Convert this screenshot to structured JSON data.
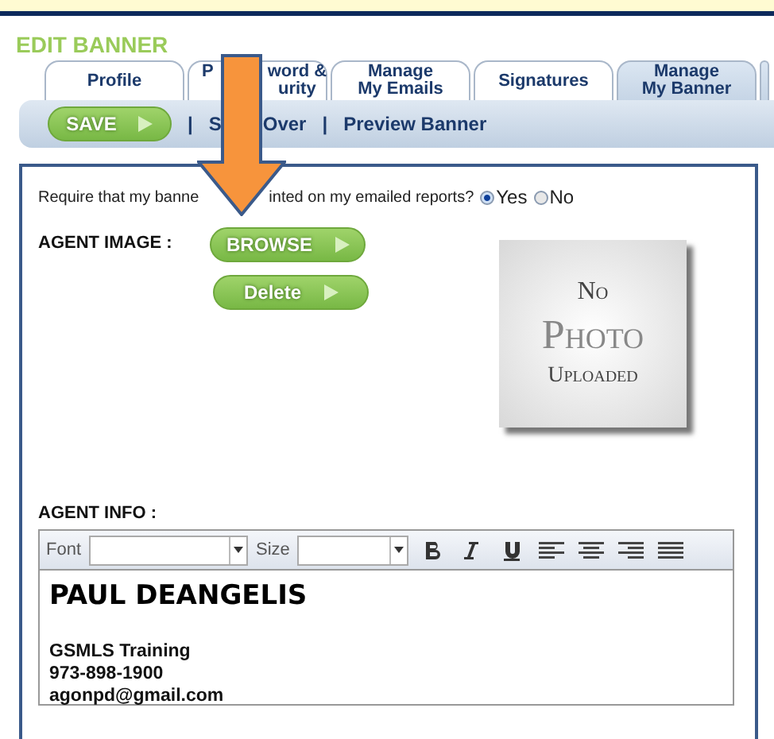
{
  "section_title": "EDIT BANNER",
  "tabs": [
    {
      "lines": [
        "Profile"
      ],
      "selected": false
    },
    {
      "lines": [
        {
          "before": "P",
          "after": "word &"
        },
        {
          "after": "urity"
        }
      ],
      "selected": false
    },
    {
      "lines": [
        "Manage",
        "My Emails"
      ],
      "selected": false
    },
    {
      "lines": [
        "Signatures"
      ],
      "selected": false
    },
    {
      "lines": [
        "Manage",
        "My Banner"
      ],
      "selected": true
    }
  ],
  "toolbar": [
    {
      "kind": "button",
      "label": "SAVE"
    },
    {
      "kind": "separator",
      "text": "|"
    },
    {
      "kind": "link",
      "before": "S",
      "after": "Over"
    },
    {
      "kind": "separator",
      "text": "|"
    },
    {
      "kind": "link",
      "label": "Preview Banner"
    }
  ],
  "question": {
    "before": "Require that my banne",
    "after": "inted on my emailed reports?",
    "options": [
      {
        "label": "Yes",
        "selected": true
      },
      {
        "label": "No",
        "selected": false
      }
    ]
  },
  "agent_image": {
    "label": "AGENT IMAGE :",
    "buttons": [
      "BROWSE",
      "Delete"
    ],
    "placeholder_lines": [
      "No",
      "Photo",
      "Uploaded"
    ]
  },
  "agent_info": {
    "label": "AGENT INFO :",
    "editor_toolbar": {
      "font_label": "Font",
      "size_label": "Size"
    },
    "content": [
      {
        "kind": "heading",
        "text": "PAUL DEANGELIS"
      },
      {
        "kind": "line",
        "text": "GSMLS Training"
      },
      {
        "kind": "line",
        "text": "973-898-1900"
      },
      {
        "kind": "line",
        "text": "agonpd@gmail.com"
      }
    ]
  }
}
